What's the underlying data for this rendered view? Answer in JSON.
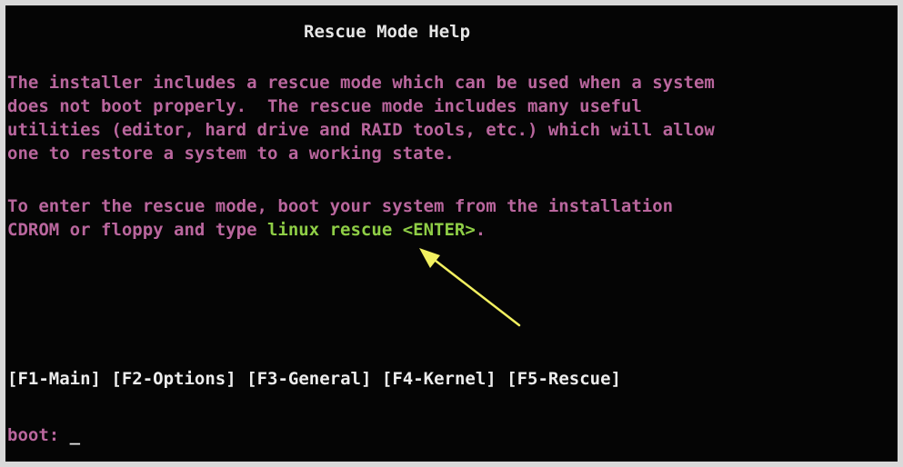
{
  "title": "Rescue Mode Help",
  "paragraph1": [
    "The installer includes a rescue mode which can be used when a system",
    "does not boot properly.  The rescue mode includes many useful",
    "utilities (editor, hard drive and RAID tools, etc.) which will allow",
    "one to restore a system to a working state."
  ],
  "paragraph2": {
    "line1": "To enter the rescue mode, boot your system from the installation",
    "line2_prefix": "CDROM or floppy and type ",
    "command": "linux rescue <ENTER>",
    "line2_suffix": "."
  },
  "function_keys": [
    "[F1-Main]",
    "[F2-Options]",
    "[F3-General]",
    "[F4-Kernel]",
    "[F5-Rescue]"
  ],
  "prompt": {
    "label": "boot: ",
    "cursor": "_"
  },
  "colors": {
    "background": "#050505",
    "body_text": "#b9669d",
    "title_text": "#e6e6e6",
    "command_text": "#8fce46",
    "arrow": "#f2f060"
  },
  "annotation": {
    "icon": "arrow-icon"
  }
}
